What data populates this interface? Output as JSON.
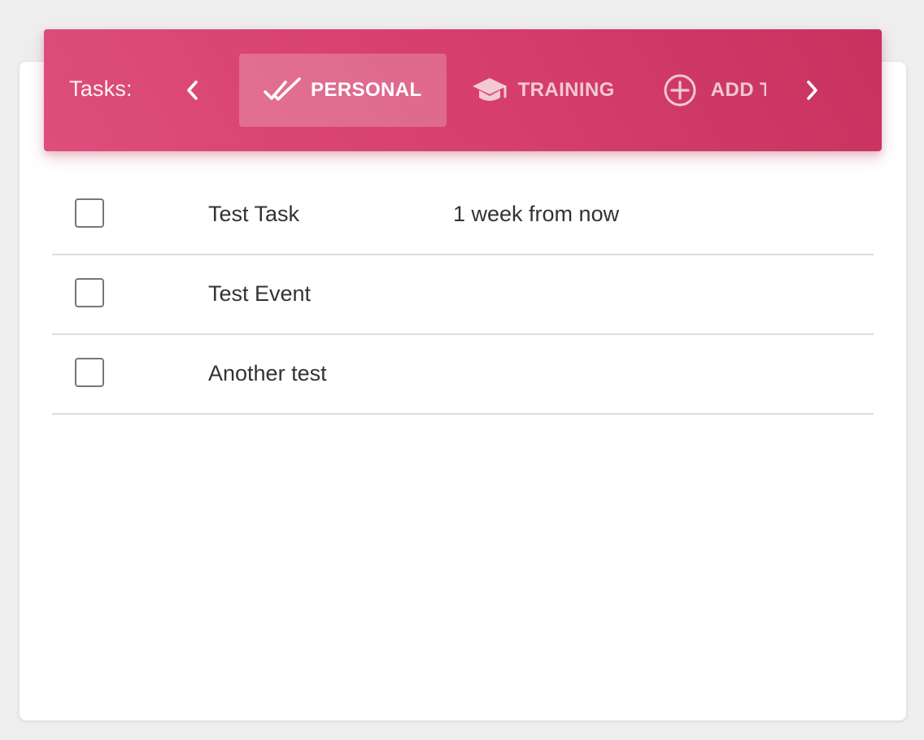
{
  "header": {
    "label": "Tasks:",
    "tabs": [
      {
        "label": "PERSONAL",
        "icon": "double-check-icon",
        "active": true
      },
      {
        "label": "TRAINING",
        "icon": "graduation-cap-icon",
        "active": false
      },
      {
        "label": "ADD TASK LIST",
        "icon": "add-circle-icon",
        "active": false
      }
    ],
    "prev_icon": "chevron-left-icon",
    "next_icon": "chevron-right-icon"
  },
  "tasks": [
    {
      "title": "Test Task",
      "due": "1 week from now",
      "checked": false
    },
    {
      "title": "Test Event",
      "due": "",
      "checked": false
    },
    {
      "title": "Another test",
      "due": "",
      "checked": false
    }
  ],
  "colors": {
    "accent": "#d63f6e",
    "accent_dark": "#c7325f",
    "background": "#eeeeee",
    "card": "#ffffff",
    "divider": "#dddddd",
    "text": "#333333"
  }
}
